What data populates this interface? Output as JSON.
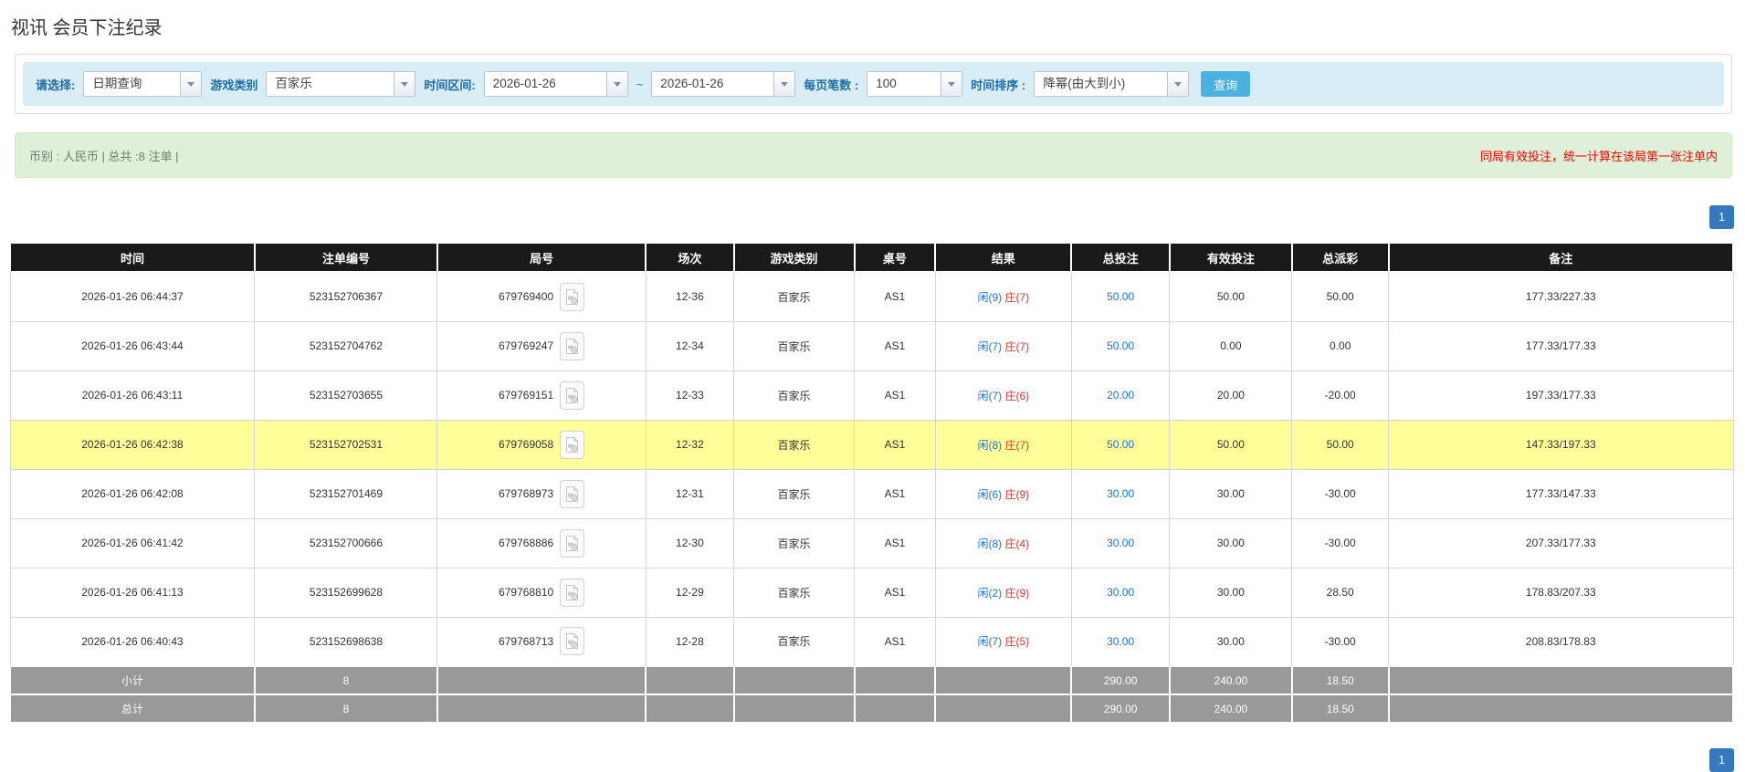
{
  "page": {
    "title": "视讯 会员下注纪录"
  },
  "colors": {
    "accent_blue": "#4ab1e0",
    "link_blue": "#1a73e8",
    "result_red": "#e8312a",
    "header_black": "#1a1a1a",
    "footer_gray": "#999999",
    "highlight_yellow": "#ffff99",
    "filter_bg": "#d9edf7",
    "summary_bg": "#dff0d8",
    "pagination_blue": "#3578bd"
  },
  "icons": {
    "combo_trigger": "chevron-down-icon",
    "round_video": "video-file-icon"
  },
  "filters": {
    "select_label": "请选择:",
    "select_value": "日期查询",
    "game_type_label": "游戏类别",
    "game_type_value": "百家乐",
    "time_range_label": "时间区间:",
    "date_from": "2026-01-26",
    "tilde": "~",
    "date_to": "2026-01-26",
    "page_size_label": "每页笔数 :",
    "page_size_value": "100",
    "sort_label": "时间排序 :",
    "sort_value": "降幂(由大到小)",
    "search_button": "查询"
  },
  "summary_bar": {
    "left_text": "币别 : 人民币 | 总共 :8 注单 |",
    "right_text": "同局有效投注，统一计算在该局第一张注单内"
  },
  "pagination": {
    "page": "1"
  },
  "table": {
    "headers": [
      "时间",
      "注单编号",
      "局号",
      "场次",
      "游戏类别",
      "桌号",
      "结果",
      "总投注",
      "有效投注",
      "总派彩",
      "备注"
    ],
    "col_widths_pct": [
      14.2,
      10.6,
      12.1,
      5.1,
      7.0,
      4.7,
      7.9,
      5.7,
      7.1,
      5.6,
      20.0
    ],
    "rows": [
      {
        "time": "2026-01-26 06:44:37",
        "bet_id": "523152706367",
        "round_id": "679769400",
        "session": "12-36",
        "game": "百家乐",
        "table_no": "AS1",
        "result_player": "闲(9)",
        "result_banker": "庄(7)",
        "total_bet": "50.00",
        "valid_bet": "50.00",
        "payout": "50.00",
        "note": "177.33/227.33",
        "highlight": false
      },
      {
        "time": "2026-01-26 06:43:44",
        "bet_id": "523152704762",
        "round_id": "679769247",
        "session": "12-34",
        "game": "百家乐",
        "table_no": "AS1",
        "result_player": "闲(7)",
        "result_banker": "庄(7)",
        "total_bet": "50.00",
        "valid_bet": "0.00",
        "payout": "0.00",
        "note": "177.33/177.33",
        "highlight": false
      },
      {
        "time": "2026-01-26 06:43:11",
        "bet_id": "523152703655",
        "round_id": "679769151",
        "session": "12-33",
        "game": "百家乐",
        "table_no": "AS1",
        "result_player": "闲(7)",
        "result_banker": "庄(6)",
        "total_bet": "20.00",
        "valid_bet": "20.00",
        "payout": "-20.00",
        "note": "197.33/177.33",
        "highlight": false
      },
      {
        "time": "2026-01-26 06:42:38",
        "bet_id": "523152702531",
        "round_id": "679769058",
        "session": "12-32",
        "game": "百家乐",
        "table_no": "AS1",
        "result_player": "闲(8)",
        "result_banker": "庄(7)",
        "total_bet": "50.00",
        "valid_bet": "50.00",
        "payout": "50.00",
        "note": "147.33/197.33",
        "highlight": true
      },
      {
        "time": "2026-01-26 06:42:08",
        "bet_id": "523152701469",
        "round_id": "679768973",
        "session": "12-31",
        "game": "百家乐",
        "table_no": "AS1",
        "result_player": "闲(6)",
        "result_banker": "庄(9)",
        "total_bet": "30.00",
        "valid_bet": "30.00",
        "payout": "-30.00",
        "note": "177.33/147.33",
        "highlight": false
      },
      {
        "time": "2026-01-26 06:41:42",
        "bet_id": "523152700666",
        "round_id": "679768886",
        "session": "12-30",
        "game": "百家乐",
        "table_no": "AS1",
        "result_player": "闲(8)",
        "result_banker": "庄(4)",
        "total_bet": "30.00",
        "valid_bet": "30.00",
        "payout": "-30.00",
        "note": "207.33/177.33",
        "highlight": false
      },
      {
        "time": "2026-01-26 06:41:13",
        "bet_id": "523152699628",
        "round_id": "679768810",
        "session": "12-29",
        "game": "百家乐",
        "table_no": "AS1",
        "result_player": "闲(2)",
        "result_banker": "庄(9)",
        "total_bet": "30.00",
        "valid_bet": "30.00",
        "payout": "28.50",
        "note": "178.83/207.33",
        "highlight": false
      },
      {
        "time": "2026-01-26 06:40:43",
        "bet_id": "523152698638",
        "round_id": "679768713",
        "session": "12-28",
        "game": "百家乐",
        "table_no": "AS1",
        "result_player": "闲(7)",
        "result_banker": "庄(5)",
        "total_bet": "30.00",
        "valid_bet": "30.00",
        "payout": "-30.00",
        "note": "208.83/178.83",
        "highlight": false
      }
    ],
    "subtotal": {
      "label": "小计",
      "count": "8",
      "total_bet": "290.00",
      "valid_bet": "240.00",
      "payout": "18.50"
    },
    "total": {
      "label": "总计",
      "count": "8",
      "total_bet": "290.00",
      "valid_bet": "240.00",
      "payout": "18.50"
    }
  }
}
